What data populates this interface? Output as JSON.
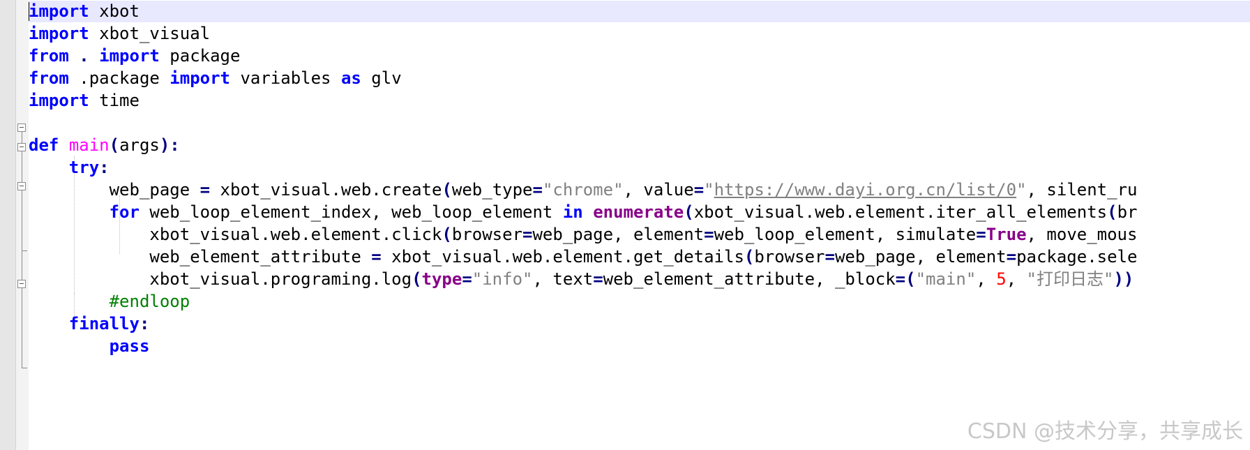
{
  "editor": {
    "theme_colors": {
      "keyword": "#0000ff",
      "function_name": "#ff00ff",
      "string": "#808080",
      "number": "#ff0000",
      "comment": "#008000",
      "current_line": "#e8e8ff"
    },
    "lines": [
      [
        {
          "t": "import",
          "c": "kw"
        },
        {
          "t": " xbot",
          "c": ""
        }
      ],
      [
        {
          "t": "import",
          "c": "kw"
        },
        {
          "t": " xbot_visual",
          "c": ""
        }
      ],
      [
        {
          "t": "from",
          "c": "kw"
        },
        {
          "t": " ",
          "c": ""
        },
        {
          "t": ".",
          "c": "op"
        },
        {
          "t": " ",
          "c": ""
        },
        {
          "t": "import",
          "c": "kw"
        },
        {
          "t": " package",
          "c": ""
        }
      ],
      [
        {
          "t": "from",
          "c": "kw"
        },
        {
          "t": " .package ",
          "c": ""
        },
        {
          "t": "import",
          "c": "kw"
        },
        {
          "t": " variables ",
          "c": ""
        },
        {
          "t": "as",
          "c": "kw"
        },
        {
          "t": " glv",
          "c": ""
        }
      ],
      [
        {
          "t": "import",
          "c": "kw"
        },
        {
          "t": " time",
          "c": ""
        }
      ],
      [],
      [
        {
          "t": "def",
          "c": "kw"
        },
        {
          "t": " ",
          "c": ""
        },
        {
          "t": "main",
          "c": "fn"
        },
        {
          "t": "(",
          "c": "op"
        },
        {
          "t": "args",
          "c": ""
        },
        {
          "t": "):",
          "c": "op"
        }
      ],
      [
        {
          "t": "    ",
          "c": ""
        },
        {
          "t": "try",
          "c": "kw"
        },
        {
          "t": ":",
          "c": "op"
        }
      ],
      [
        {
          "t": "        web_page ",
          "c": ""
        },
        {
          "t": "=",
          "c": "op"
        },
        {
          "t": " xbot_visual.web.create",
          "c": ""
        },
        {
          "t": "(",
          "c": "op"
        },
        {
          "t": "web_type",
          "c": ""
        },
        {
          "t": "=",
          "c": "op"
        },
        {
          "t": "\"chrome\"",
          "c": "str"
        },
        {
          "t": ", value",
          "c": ""
        },
        {
          "t": "=",
          "c": "op"
        },
        {
          "t": "\"",
          "c": "str"
        },
        {
          "t": "https://www.dayi.org.cn/list/0",
          "c": "url"
        },
        {
          "t": "\"",
          "c": "str"
        },
        {
          "t": ", silent_ru",
          "c": ""
        }
      ],
      [
        {
          "t": "        ",
          "c": ""
        },
        {
          "t": "for",
          "c": "kw"
        },
        {
          "t": " web_loop_element_index, web_loop_element ",
          "c": ""
        },
        {
          "t": "in",
          "c": "kw"
        },
        {
          "t": " ",
          "c": ""
        },
        {
          "t": "enumerate",
          "c": "kw2"
        },
        {
          "t": "(",
          "c": "op"
        },
        {
          "t": "xbot_visual.web.element.iter_all_elements",
          "c": ""
        },
        {
          "t": "(",
          "c": "op"
        },
        {
          "t": "br",
          "c": ""
        }
      ],
      [
        {
          "t": "            xbot_visual.web.element.click",
          "c": ""
        },
        {
          "t": "(",
          "c": "op"
        },
        {
          "t": "browser",
          "c": ""
        },
        {
          "t": "=",
          "c": "op"
        },
        {
          "t": "web_page, element",
          "c": ""
        },
        {
          "t": "=",
          "c": "op"
        },
        {
          "t": "web_loop_element, simulate",
          "c": ""
        },
        {
          "t": "=",
          "c": "op"
        },
        {
          "t": "True",
          "c": "kw2"
        },
        {
          "t": ", move_mous",
          "c": ""
        }
      ],
      [
        {
          "t": "            web_element_attribute ",
          "c": ""
        },
        {
          "t": "=",
          "c": "op"
        },
        {
          "t": " xbot_visual.web.element.get_details",
          "c": ""
        },
        {
          "t": "(",
          "c": "op"
        },
        {
          "t": "browser",
          "c": ""
        },
        {
          "t": "=",
          "c": "op"
        },
        {
          "t": "web_page, element",
          "c": ""
        },
        {
          "t": "=",
          "c": "op"
        },
        {
          "t": "package.sele",
          "c": ""
        }
      ],
      [
        {
          "t": "            xbot_visual.programing.log",
          "c": ""
        },
        {
          "t": "(",
          "c": "op"
        },
        {
          "t": "type",
          "c": "kw2"
        },
        {
          "t": "=",
          "c": "op"
        },
        {
          "t": "\"info\"",
          "c": "str"
        },
        {
          "t": ", text",
          "c": ""
        },
        {
          "t": "=",
          "c": "op"
        },
        {
          "t": "web_element_attribute, _block",
          "c": ""
        },
        {
          "t": "=(",
          "c": "op"
        },
        {
          "t": "\"main\"",
          "c": "str"
        },
        {
          "t": ", ",
          "c": ""
        },
        {
          "t": "5",
          "c": "num"
        },
        {
          "t": ", ",
          "c": ""
        },
        {
          "t": "\"打印日志\"",
          "c": "str"
        },
        {
          "t": "))",
          "c": "op"
        }
      ],
      [
        {
          "t": "        ",
          "c": ""
        },
        {
          "t": "#endloop",
          "c": "cmt"
        }
      ],
      [
        {
          "t": "    ",
          "c": ""
        },
        {
          "t": "finally",
          "c": "kw"
        },
        {
          "t": ":",
          "c": "op"
        }
      ],
      [
        {
          "t": "        ",
          "c": ""
        },
        {
          "t": "pass",
          "c": "kw"
        }
      ]
    ]
  },
  "watermark": "CSDN @技术分享，共享成长"
}
